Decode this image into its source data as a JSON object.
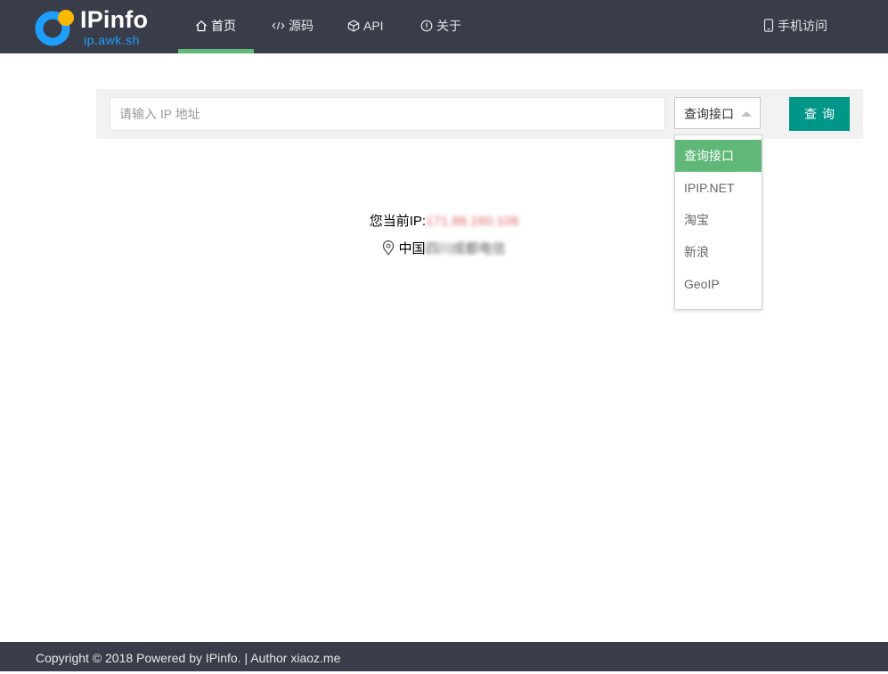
{
  "brand": {
    "name": "IPinfo",
    "domain": "ip.awk.sh",
    "accent_color": "#1E9FFF",
    "mark_colors": [
      "#1E9FFF",
      "#FFB800"
    ]
  },
  "nav": {
    "items": [
      {
        "label": "首页",
        "icon": "home-icon",
        "active": true
      },
      {
        "label": "源码",
        "icon": "code-icon"
      },
      {
        "label": "API",
        "icon": "cube-icon"
      },
      {
        "label": "关于",
        "icon": "info-icon"
      }
    ],
    "mobile": {
      "label": "手机访问",
      "icon": "mobile-icon"
    },
    "active_color": "#5FB878"
  },
  "search": {
    "placeholder": "请输入 IP 地址",
    "value": "",
    "select_value": "查询接口",
    "button_label": "查询",
    "button_color": "#009688"
  },
  "dropdown": {
    "options": [
      "查询接口",
      "IPIP.NET",
      "淘宝",
      "新浪",
      "GeoIP"
    ],
    "selected_index": 0,
    "selected_color": "#5FB878"
  },
  "result": {
    "ip_label": "您当前IP:",
    "ip_value": "171.88.160.108",
    "location_prefix": "中国",
    "location_rest": "四川成都电信",
    "location_icon": "location-pin-icon"
  },
  "footer": {
    "text": "Copyright © 2018 Powered by IPinfo. | Author xiaoz.me",
    "background": "#393D49"
  }
}
